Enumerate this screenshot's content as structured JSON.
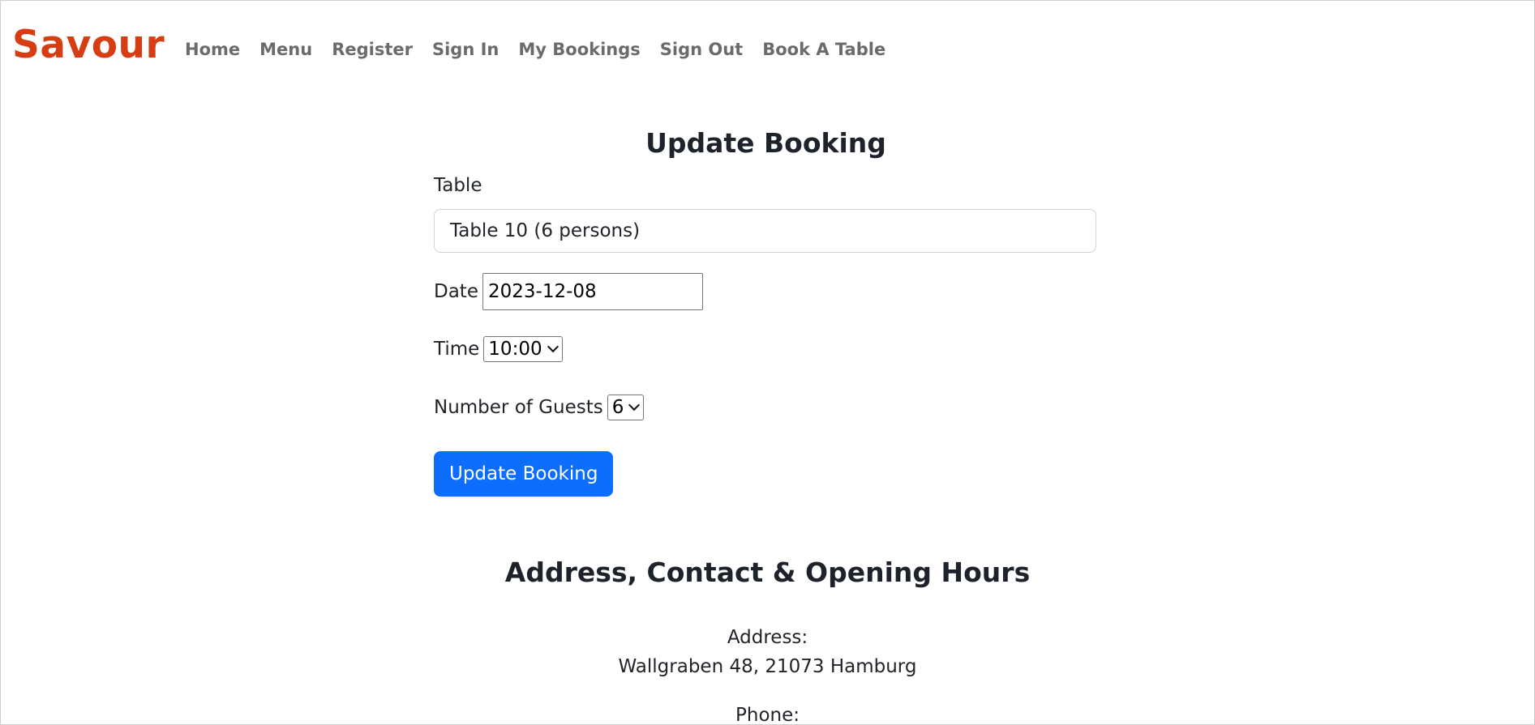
{
  "navbar": {
    "brand": "Savour",
    "links": [
      {
        "label": "Home"
      },
      {
        "label": "Menu"
      },
      {
        "label": "Register"
      },
      {
        "label": "Sign In"
      },
      {
        "label": "My Bookings"
      },
      {
        "label": "Sign Out"
      },
      {
        "label": "Book A Table"
      }
    ]
  },
  "form": {
    "title": "Update Booking",
    "table_label": "Table",
    "table_value": "Table 10 (6 persons)",
    "date_label": "Date",
    "date_value": "2023-12-08",
    "time_label": "Time",
    "time_value": "10:00",
    "guests_label": "Number of Guests",
    "guests_value": "6",
    "submit_label": "Update Booking"
  },
  "info": {
    "title": "Address, Contact & Opening Hours",
    "address_label": "Address:",
    "address_value": "Wallgraben 48, 21073 Hamburg",
    "phone_label": "Phone:"
  },
  "colors": {
    "brand": "#d63d12",
    "nav_link": "#6b6b6b",
    "primary_button": "#0d6efd",
    "heading": "#1e232b"
  }
}
